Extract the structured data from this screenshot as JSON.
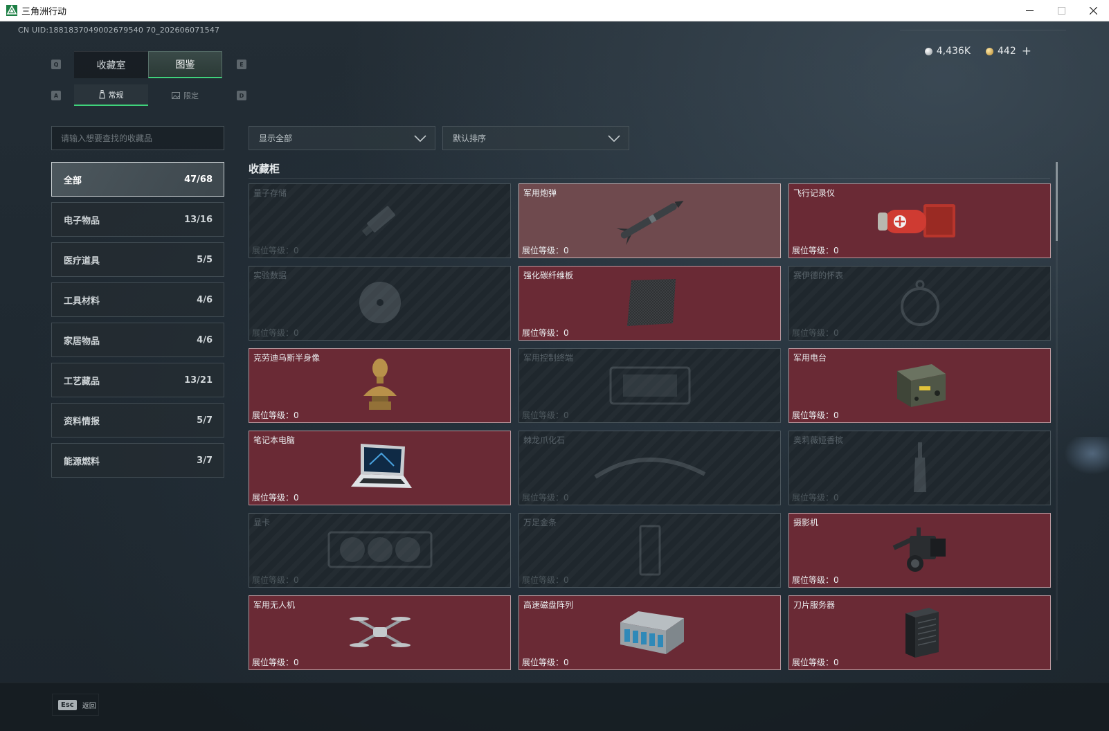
{
  "window": {
    "title": "三角洲行动",
    "controls": [
      "minimize-icon",
      "maximize-icon",
      "close-icon"
    ]
  },
  "uid": "CN UID:1881837049002679540 70_202606071547",
  "currency": {
    "silver": "4,436K",
    "gold": "442",
    "plus": "+"
  },
  "keyhints": {
    "q": "Q",
    "e": "E",
    "a": "A",
    "d": "D"
  },
  "tabs": [
    {
      "label": "收藏室",
      "active": false
    },
    {
      "label": "图鉴",
      "active": true
    }
  ],
  "subtabs": [
    {
      "label": "常规",
      "icon": "bottle-icon",
      "active": true
    },
    {
      "label": "限定",
      "icon": "image-icon",
      "active": false
    }
  ],
  "search": {
    "placeholder": "请输入想要查找的收藏品",
    "value": ""
  },
  "filters": {
    "display": "显示全部",
    "sort": "默认排序"
  },
  "categories": [
    {
      "name": "全部",
      "count": "47/68",
      "active": true
    },
    {
      "name": "电子物品",
      "count": "13/16"
    },
    {
      "name": "医疗道具",
      "count": "5/5"
    },
    {
      "name": "工具材料",
      "count": "4/6"
    },
    {
      "name": "家居物品",
      "count": "4/6"
    },
    {
      "name": "工艺藏品",
      "count": "13/21"
    },
    {
      "name": "资料情报",
      "count": "5/7"
    },
    {
      "name": "能源燃料",
      "count": "3/7"
    }
  ],
  "section_title": "收藏柜",
  "level_label": "展位等级：",
  "items": [
    {
      "name": "量子存储",
      "level": "0",
      "state": "locked",
      "icon": "usb-drive-icon"
    },
    {
      "name": "军用炮弹",
      "level": "0",
      "state": "highlighted",
      "icon": "missile-icon"
    },
    {
      "name": "飞行记录仪",
      "level": "0",
      "state": "owned",
      "icon": "flight-recorder-icon"
    },
    {
      "name": "实验数据",
      "level": "0",
      "state": "locked",
      "icon": "disc-icon"
    },
    {
      "name": "强化碳纤维板",
      "level": "0",
      "state": "owned",
      "icon": "carbon-plate-icon"
    },
    {
      "name": "赛伊德的怀表",
      "level": "0",
      "state": "locked",
      "icon": "pocket-watch-icon"
    },
    {
      "name": "克劳迪乌斯半身像",
      "level": "0",
      "state": "owned",
      "icon": "bust-icon"
    },
    {
      "name": "军用控制终端",
      "level": "0",
      "state": "locked",
      "icon": "terminal-icon"
    },
    {
      "name": "军用电台",
      "level": "0",
      "state": "owned",
      "icon": "radio-icon"
    },
    {
      "name": "笔记本电脑",
      "level": "0",
      "state": "owned",
      "icon": "laptop-icon"
    },
    {
      "name": "棘龙爪化石",
      "level": "0",
      "state": "locked",
      "icon": "fossil-icon"
    },
    {
      "name": "奥莉薇娅香槟",
      "level": "0",
      "state": "locked",
      "icon": "champagne-icon"
    },
    {
      "name": "显卡",
      "level": "0",
      "state": "locked",
      "icon": "gpu-icon"
    },
    {
      "name": "万足金条",
      "level": "0",
      "state": "locked",
      "icon": "gold-bar-icon"
    },
    {
      "name": "摄影机",
      "level": "0",
      "state": "owned",
      "icon": "camera-icon"
    },
    {
      "name": "军用无人机",
      "level": "0",
      "state": "owned",
      "icon": "drone-icon"
    },
    {
      "name": "高速磁盘阵列",
      "level": "0",
      "state": "owned",
      "icon": "disk-array-icon"
    },
    {
      "name": "刀片服务器",
      "level": "0",
      "state": "owned",
      "icon": "blade-server-icon"
    }
  ],
  "footer": {
    "esc": "Esc",
    "back": "返回"
  }
}
